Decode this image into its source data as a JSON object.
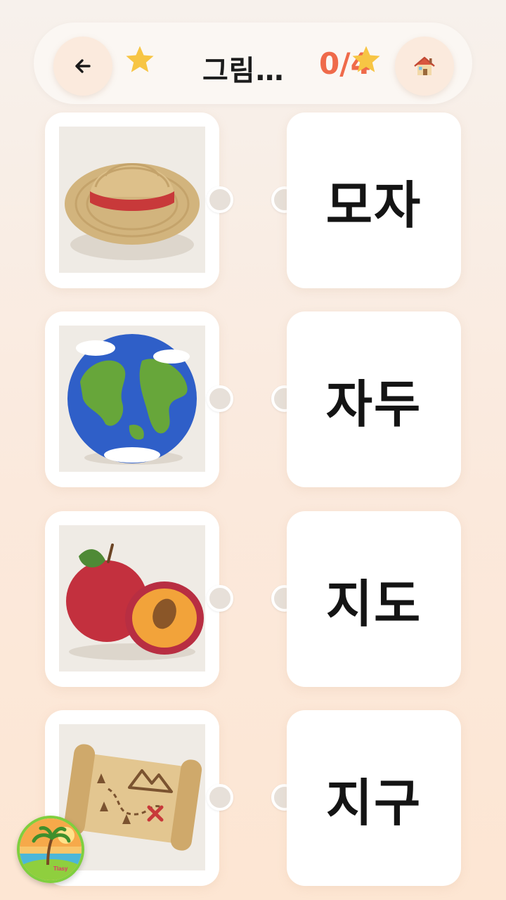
{
  "header": {
    "back_icon": "arrow-left-icon",
    "title": "그림…",
    "score": "0/4",
    "home_icon": "house-icon",
    "star_color": "#f7c544",
    "score_color": "#ef6a4a"
  },
  "pictures": [
    {
      "subject": "hat",
      "icon": "felt-straw-hat-image"
    },
    {
      "subject": "earth",
      "icon": "felt-globe-image"
    },
    {
      "subject": "plum",
      "icon": "felt-plum-image"
    },
    {
      "subject": "map",
      "icon": "felt-treasure-map-image"
    }
  ],
  "words": [
    "모자",
    "자두",
    "지도",
    "지구"
  ],
  "logo": {
    "icon": "island-logo-icon",
    "text": "Tlasy"
  }
}
